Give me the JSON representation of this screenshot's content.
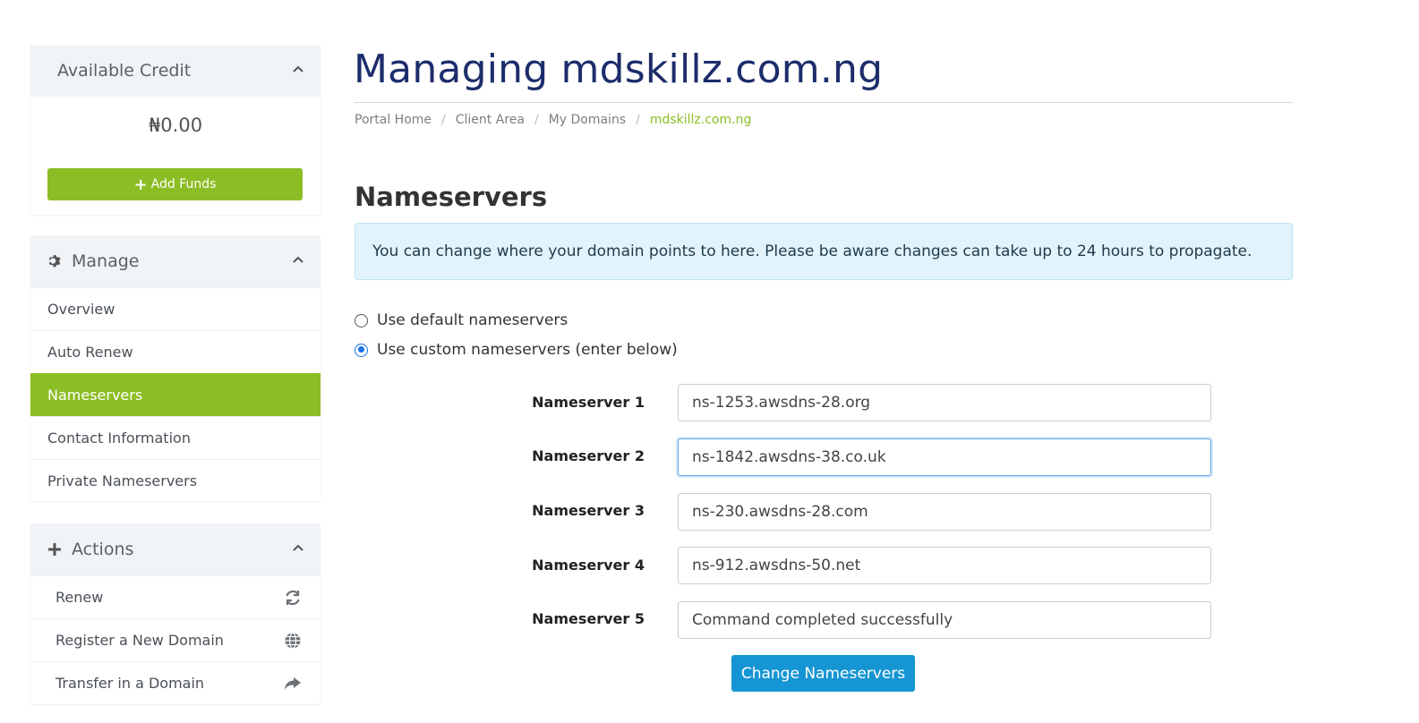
{
  "sidebar": {
    "credit": {
      "title": "Available Credit",
      "amount": "₦0.00",
      "add_funds_label": "Add Funds"
    },
    "manage": {
      "title": "Manage",
      "items": [
        {
          "label": "Overview"
        },
        {
          "label": "Auto Renew"
        },
        {
          "label": "Nameservers"
        },
        {
          "label": "Contact Information"
        },
        {
          "label": "Private Nameservers"
        }
      ],
      "active_item": "Nameservers"
    },
    "actions": {
      "title": "Actions",
      "items": [
        {
          "label": "Renew",
          "icon": "refresh-icon"
        },
        {
          "label": "Register a New Domain",
          "icon": "globe-icon"
        },
        {
          "label": "Transfer in a Domain",
          "icon": "share-arrow-icon"
        }
      ]
    }
  },
  "main": {
    "title": "Managing mdskillz.com.ng",
    "breadcrumb": [
      "Portal Home",
      "Client Area",
      "My Domains",
      "mdskillz.com.ng"
    ],
    "section_title": "Nameservers",
    "alert": "You can change where your domain points to here. Please be aware changes can take up to 24 hours to propagate.",
    "options": [
      {
        "label": "Use default nameservers",
        "selected": false
      },
      {
        "label": "Use custom nameservers (enter below)",
        "selected": true
      }
    ],
    "nameservers": [
      {
        "label": "Nameserver 1",
        "value": "ns-1253.awsdns-28.org"
      },
      {
        "label": "Nameserver 2",
        "value": "ns-1842.awsdns-38.co.uk"
      },
      {
        "label": "Nameserver 3",
        "value": "ns-230.awsdns-28.com"
      },
      {
        "label": "Nameserver 4",
        "value": "ns-912.awsdns-50.net"
      },
      {
        "label": "Nameserver 5",
        "value": "Command completed successfully"
      }
    ],
    "submit_label": "Change Nameservers"
  },
  "colors": {
    "accent_green": "#8bbe24",
    "primary_blue": "#1595d3",
    "title_navy": "#1d2d6b",
    "alert_bg": "#e3f3fb"
  }
}
